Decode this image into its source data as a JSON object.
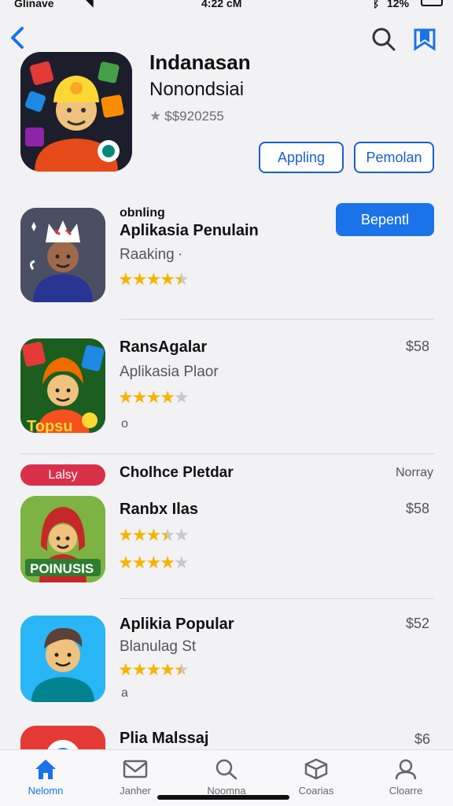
{
  "status_bar": {
    "carrier": "Glinave",
    "time": "4:22 cM",
    "battery": "12%"
  },
  "hero": {
    "title": "Indanasan",
    "subtitle": "Nonondsiai",
    "price": "$$920255",
    "button_primary": "Appling",
    "button_secondary": "Pemolan"
  },
  "featured": {
    "tag": "obnling",
    "title": "Aplikasia Penulain",
    "subtitle": "Raaking",
    "subtitle_mark": "⸱",
    "rating": 4.5,
    "action_label": "Bepentl"
  },
  "apps": [
    {
      "title": "RansAgalar",
      "subtitle": "Aplikasia Plaor",
      "rating": 4,
      "extra": "o",
      "price": "$58"
    },
    {
      "title": "Ranbx Ilas",
      "rating_primary": 3.5,
      "rating_secondary": 4,
      "price": "$58"
    },
    {
      "title": "Aplikia Popular",
      "subtitle": "Blanulag St",
      "rating": 4.5,
      "extra": "a",
      "price": "$52"
    },
    {
      "title": "Plia Malssaj",
      "price": "$6"
    }
  ],
  "section": {
    "badge": "Lalsy",
    "title": "Cholhce Pletdar",
    "link": "Norray"
  },
  "tab_bar": [
    {
      "label": "Nelomn",
      "icon": "home-icon",
      "active": true
    },
    {
      "label": "Janher",
      "icon": "mail-icon",
      "active": false
    },
    {
      "label": "Noomna",
      "icon": "search-icon",
      "active": false
    },
    {
      "label": "Coarias",
      "icon": "box-icon",
      "active": false
    },
    {
      "label": "Cloarre",
      "icon": "person-icon",
      "active": false
    }
  ],
  "colors": {
    "accent": "#1a73e8",
    "badge": "#d9304a",
    "star": "#f5b400"
  }
}
